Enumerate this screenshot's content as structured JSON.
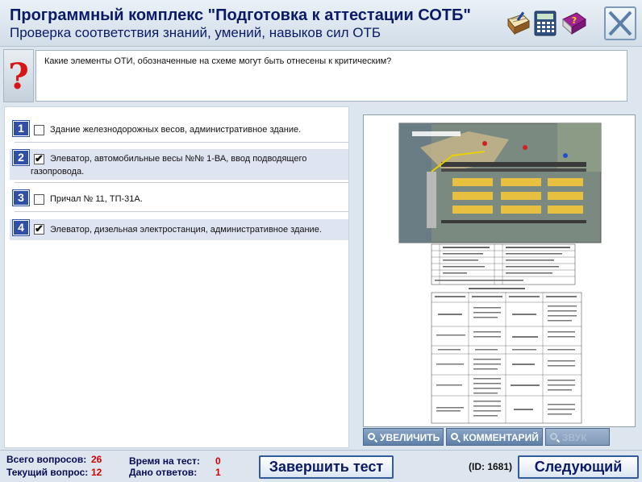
{
  "header": {
    "title": "Программный комплекс \"Подготовка к аттестации СОТБ\"",
    "subtitle": "Проверка соответствия знаний, умений, навыков сил ОТБ",
    "tools": [
      "notes-icon",
      "calculator-icon",
      "help-book-icon"
    ],
    "help_book_letter": "?"
  },
  "question": {
    "icon": "?",
    "text": "Какие элементы ОТИ, обозначенные на схеме могут быть отнесены к критическим?"
  },
  "answers": [
    {
      "num": "1",
      "text_line1": "Здание железнодорожных весов, административное здание.",
      "text_line2": "",
      "checked": false
    },
    {
      "num": "2",
      "text_line1": "Элеватор, автомобильные весы №№ 1-ВА, ввод подводящего",
      "text_line2": "газопровода.",
      "checked": true
    },
    {
      "num": "3",
      "text_line1": "Причал № 11, ТП-31А.",
      "text_line2": "",
      "checked": false
    },
    {
      "num": "4",
      "text_line1": "Элеватор, дизельная электростанция, административное здание.",
      "text_line2": "",
      "checked": true
    }
  ],
  "check_mark": "✔",
  "image_panel": {
    "zoom_label": "УВЕЛИЧИТЬ",
    "comment_label": "КОММЕНТАРИЙ",
    "sound_label": "ЗВУК"
  },
  "footer": {
    "total_label": "Всего вопросов:",
    "total_value": "26",
    "current_label": "Текущий вопрос:",
    "current_value": "12",
    "time_label": "Время на тест:",
    "time_value": "0",
    "answered_label": "Дано ответов:",
    "answered_value": "1",
    "finish_label": "Завершить тест",
    "id_label": "(ID: 1681)",
    "next_label": "Следующий"
  }
}
